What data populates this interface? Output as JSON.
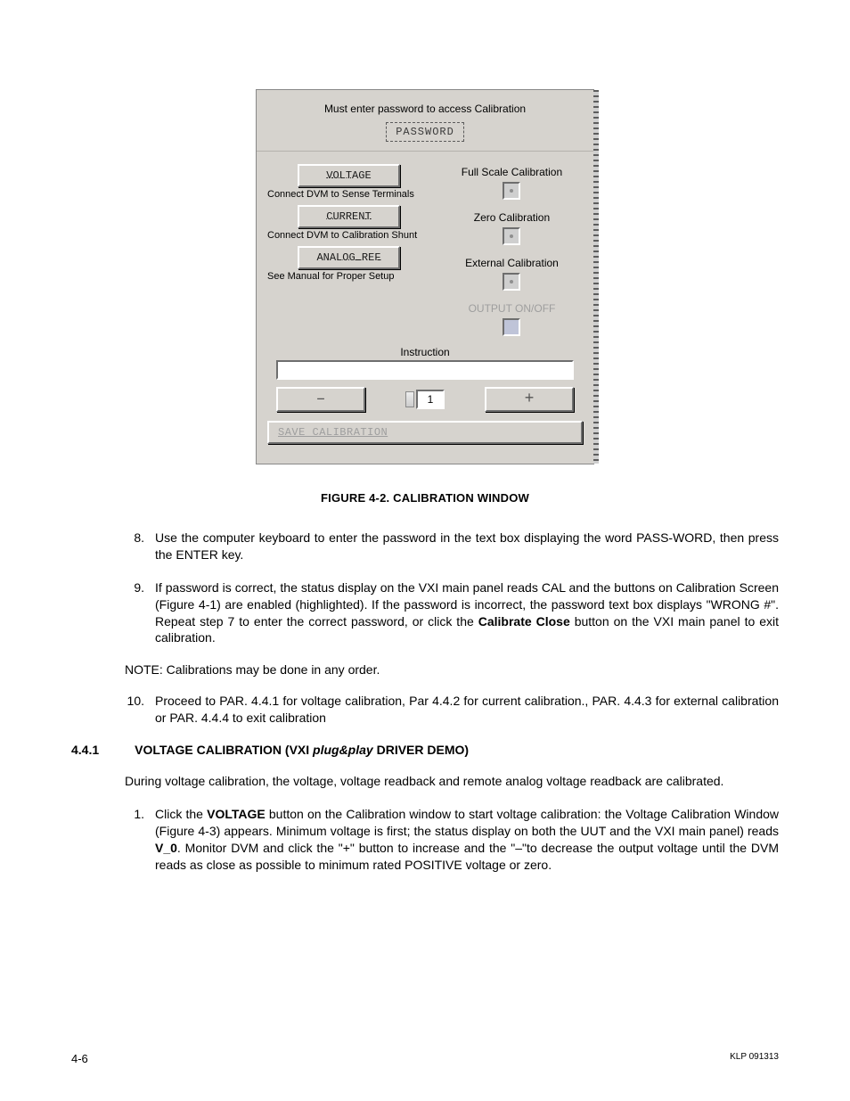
{
  "window": {
    "prompt": "Must enter password to access Calibration",
    "password_btn": "PASSWORD",
    "left": {
      "voltage_btn": "VOLTAGE",
      "voltage_hint": "Connect DVM to Sense Terminals",
      "current_btn": "CURRENT",
      "current_hint": "Connect DVM to Calibration Shunt",
      "analog_btn": "ANALOG REF",
      "analog_hint": "See Manual for Proper Setup"
    },
    "right": {
      "full_scale": "Full Scale Calibration",
      "zero": "Zero Calibration",
      "external": "External Calibration",
      "output": "OUTPUT ON/OFF"
    },
    "instruction_label": "Instruction",
    "step_value": "1",
    "minus": "–",
    "plus": "+",
    "save_btn": "SAVE CALIBRATION"
  },
  "caption": "FIGURE 4-2.  CALIBRATION WINDOW",
  "items": {
    "i8_num": "8.",
    "i8": "Use the computer keyboard to enter the password in the text box displaying the word PASS-WORD, then press the ENTER key.",
    "i9_num": "9.",
    "i9_a": "If password is correct, the status display on the VXI main panel reads CAL and the buttons on Calibration Screen (Figure 4-1) are enabled (highlighted). If the password is incorrect, the password text box displays \"WRONG #\". Repeat step 7 to enter the correct password, or click the ",
    "i9_bold": "Calibrate Close",
    "i9_b": " button on the VXI main panel to exit calibration.",
    "note": "NOTE: Calibrations may be done in any order.",
    "i10_num": "10.",
    "i10": "Proceed to PAR. 4.4.1 for voltage calibration, Par 4.4.2 for current calibration., PAR. 4.4.3 for external calibration or PAR. 4.4.4 to exit calibration"
  },
  "section": {
    "num": "4.4.1",
    "title_a": "VOLTAGE CALIBRATION (VXI ",
    "title_ital": "plug&play",
    "title_b": " DRIVER DEMO)",
    "para": "During voltage calibration, the voltage, voltage readback and remote analog voltage readback are calibrated.",
    "s1_num": "1.",
    "s1_a": "Click the ",
    "s1_bold1": "VOLTAGE",
    "s1_b": " button on the Calibration window to start voltage calibration: the Voltage Calibration Window (Figure 4-3) appears. Minimum voltage is first; the status display on both the UUT and the VXI main panel) reads ",
    "s1_bold2": "V_0",
    "s1_c": ". Monitor DVM and click the \"+\" button to increase and the \"–\"to decrease the output voltage until the DVM reads as close as possible to minimum rated POSITIVE voltage or zero."
  },
  "footer": {
    "left": "4-6",
    "right": "KLP 091313"
  }
}
